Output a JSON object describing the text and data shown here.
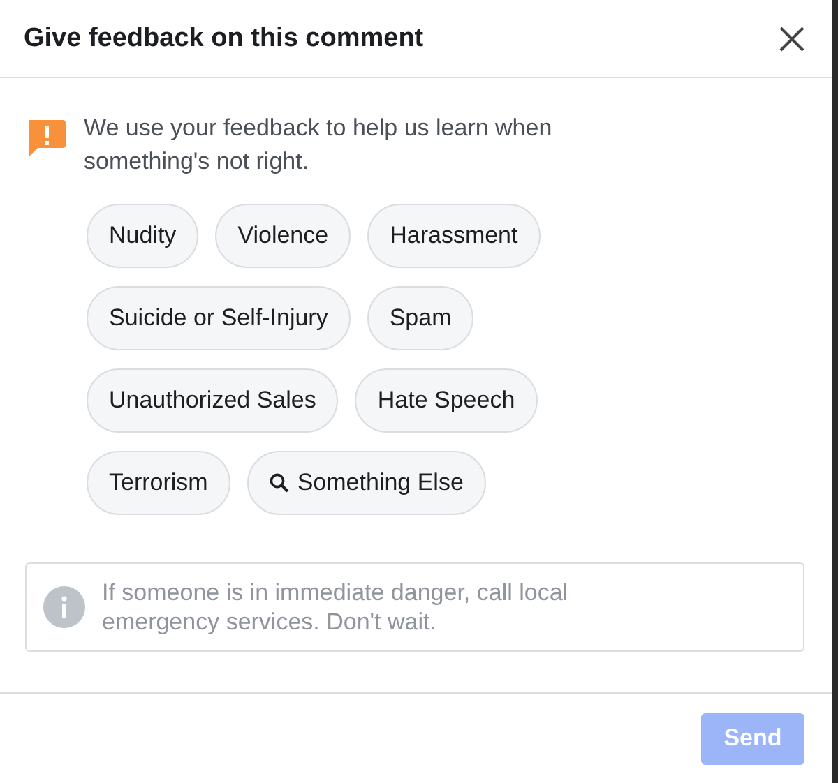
{
  "dialog": {
    "title": "Give feedback on this comment"
  },
  "intro": "We use your feedback to help us learn when something's not right.",
  "options": [
    {
      "label": "Nudity",
      "kind": "plain",
      "selected": false
    },
    {
      "label": "Violence",
      "kind": "plain",
      "selected": false
    },
    {
      "label": "Harassment",
      "kind": "plain",
      "selected": false
    },
    {
      "label": "Suicide or Self-Injury",
      "kind": "plain",
      "selected": false
    },
    {
      "label": "Spam",
      "kind": "plain",
      "selected": false
    },
    {
      "label": "Unauthorized Sales",
      "kind": "plain",
      "selected": false
    },
    {
      "label": "Hate Speech",
      "kind": "plain",
      "selected": false
    },
    {
      "label": "Terrorism",
      "kind": "plain",
      "selected": false
    },
    {
      "label": "Something Else",
      "kind": "search",
      "selected": false
    }
  ],
  "notice": "If someone is in immediate danger, call local emergency services. Don't wait.",
  "send_button": {
    "label": "Send",
    "disabled": true
  }
}
